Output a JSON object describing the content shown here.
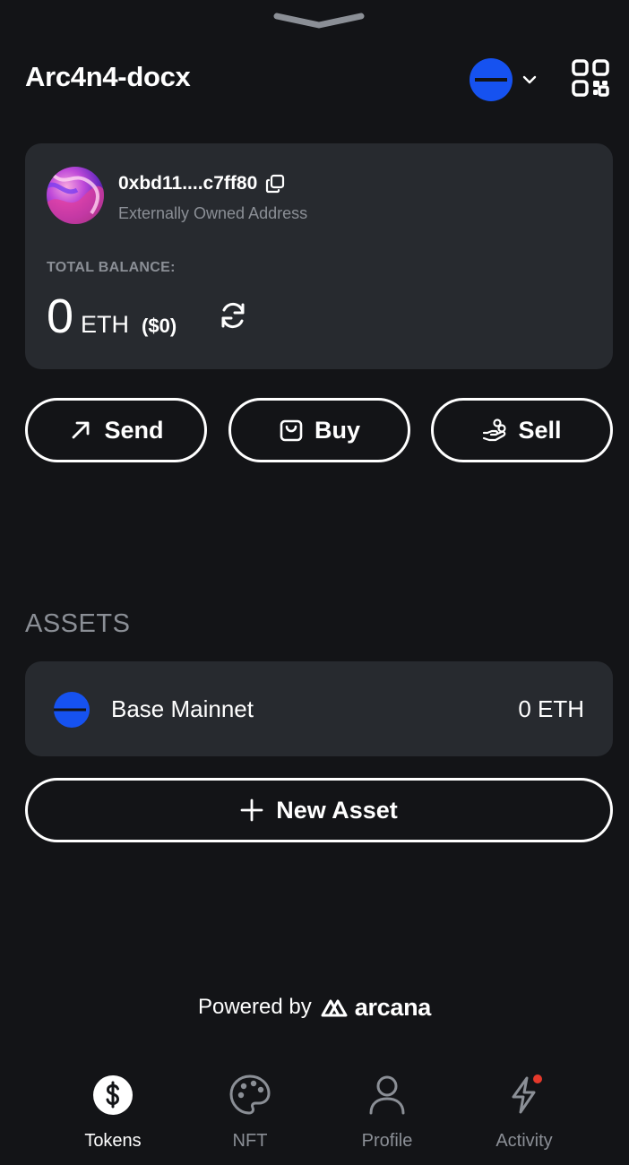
{
  "header": {
    "title": "Arc4n4-docx",
    "network_icon": "base-network-logo",
    "chevron_icon": "chevron-down-icon",
    "qr_icon": "qr-code-icon"
  },
  "account": {
    "address": "0xbd11....c7ff80",
    "address_type": "Externally Owned Address",
    "balance_label": "TOTAL BALANCE:",
    "balance_amount": "0",
    "balance_unit": "ETH",
    "balance_fiat": "($0)"
  },
  "actions": {
    "send_label": "Send",
    "buy_label": "Buy",
    "sell_label": "Sell"
  },
  "assets": {
    "title": "ASSETS",
    "items": [
      {
        "name": "Base Mainnet",
        "balance": "0 ETH",
        "icon": "base-network-logo"
      }
    ],
    "new_asset_label": "New Asset"
  },
  "footer": {
    "powered_by": "Powered by",
    "brand": "arcana"
  },
  "tabs": [
    {
      "label": "Tokens",
      "icon": "dollar-icon",
      "active": true
    },
    {
      "label": "NFT",
      "icon": "palette-icon",
      "active": false
    },
    {
      "label": "Profile",
      "icon": "user-icon",
      "active": false
    },
    {
      "label": "Activity",
      "icon": "lightning-icon",
      "active": false,
      "has_notification": true
    }
  ],
  "colors": {
    "background": "#131417",
    "card": "#272a2f",
    "muted_text": "#8b8f96",
    "base_blue": "#1652f0",
    "notification_dot": "#e5392b"
  }
}
